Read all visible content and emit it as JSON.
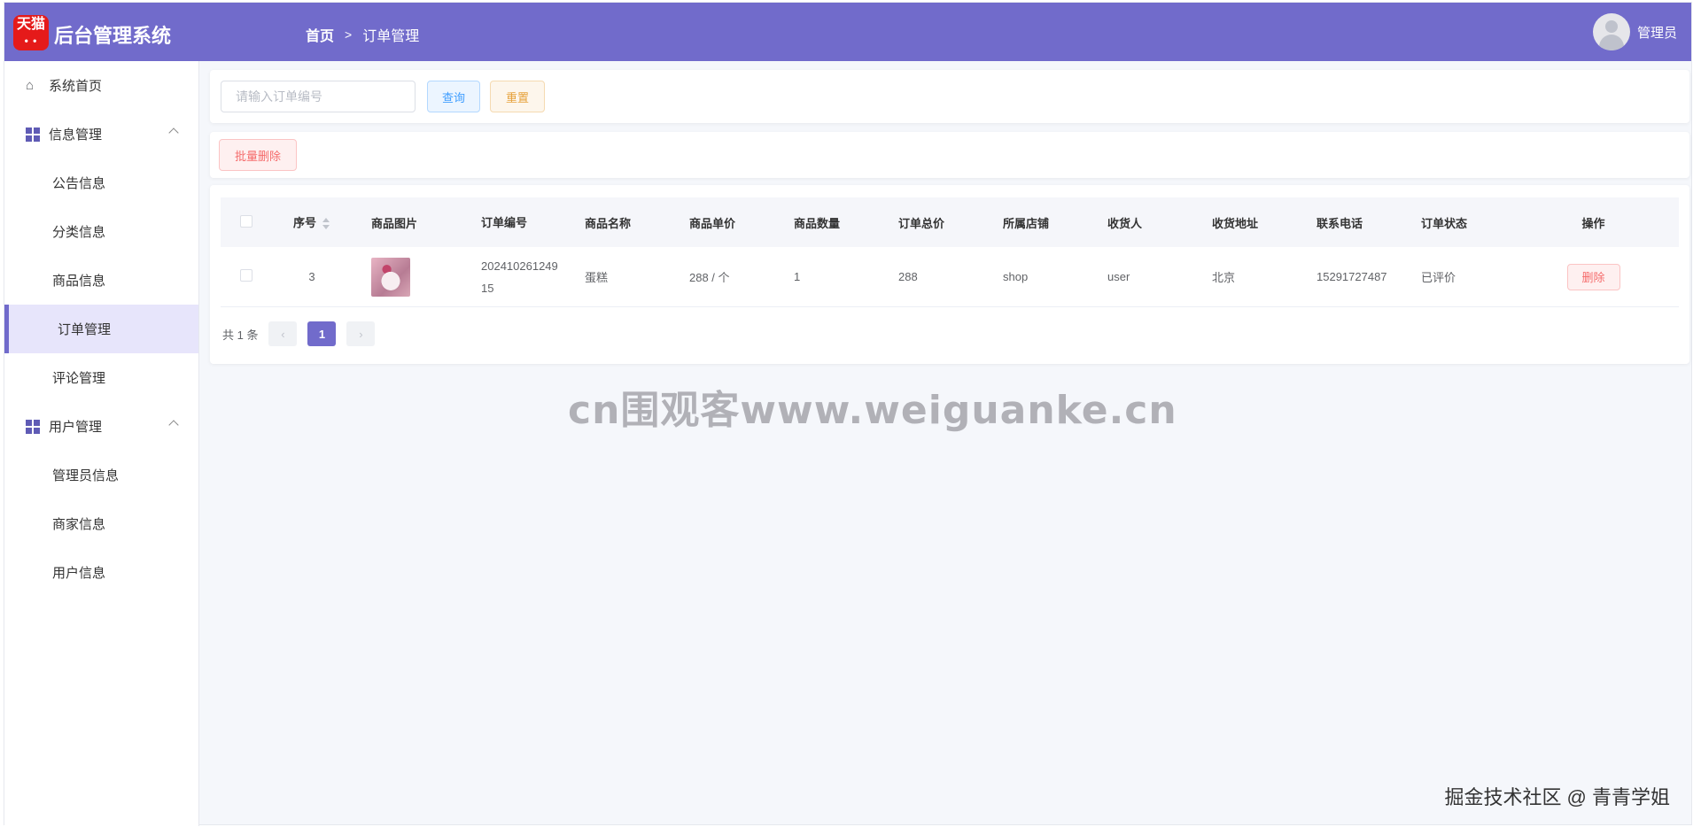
{
  "header": {
    "logo_text": "天猫",
    "title": "后台管理系统",
    "breadcrumb": [
      "首页",
      "订单管理"
    ],
    "user_name": "管理员"
  },
  "sidebar": {
    "items": [
      {
        "label": "系统首页",
        "type": "top",
        "icon": "home-icon"
      },
      {
        "label": "信息管理",
        "type": "group",
        "icon": "grid-icon"
      },
      {
        "label": "公告信息",
        "type": "sub"
      },
      {
        "label": "分类信息",
        "type": "sub"
      },
      {
        "label": "商品信息",
        "type": "sub"
      },
      {
        "label": "订单管理",
        "type": "sub",
        "active": true
      },
      {
        "label": "评论管理",
        "type": "sub"
      },
      {
        "label": "用户管理",
        "type": "group",
        "icon": "grid-icon"
      },
      {
        "label": "管理员信息",
        "type": "sub"
      },
      {
        "label": "商家信息",
        "type": "sub"
      },
      {
        "label": "用户信息",
        "type": "sub"
      }
    ]
  },
  "search": {
    "placeholder": "请输入订单编号",
    "value": "",
    "query_label": "查询",
    "reset_label": "重置"
  },
  "toolbar": {
    "batch_delete_label": "批量删除"
  },
  "table": {
    "columns": [
      "序号",
      "商品图片",
      "订单编号",
      "商品名称",
      "商品单价",
      "商品数量",
      "订单总价",
      "所属店铺",
      "收货人",
      "收货地址",
      "联系电话",
      "订单状态",
      "操作"
    ],
    "rows": [
      {
        "idx": "3",
        "order_no_line1": "202410261249",
        "order_no_line2": "15",
        "name": "蛋糕",
        "price": "288 / 个",
        "qty": "1",
        "total": "288",
        "shop": "shop",
        "receiver": "user",
        "address": "北京",
        "phone": "15291727487",
        "status": "已评价",
        "delete_label": "删除"
      }
    ]
  },
  "pagination": {
    "total_text": "共 1 条",
    "current": "1",
    "prev": "‹",
    "next": "›"
  },
  "watermark": "cn围观客www.weiguanke.cn",
  "credit": "掘金技术社区 @ 青青学姐",
  "colors": {
    "header": "#716bcb",
    "active_menu_bg": "#e7e5fb",
    "danger": "#f56c6c"
  }
}
